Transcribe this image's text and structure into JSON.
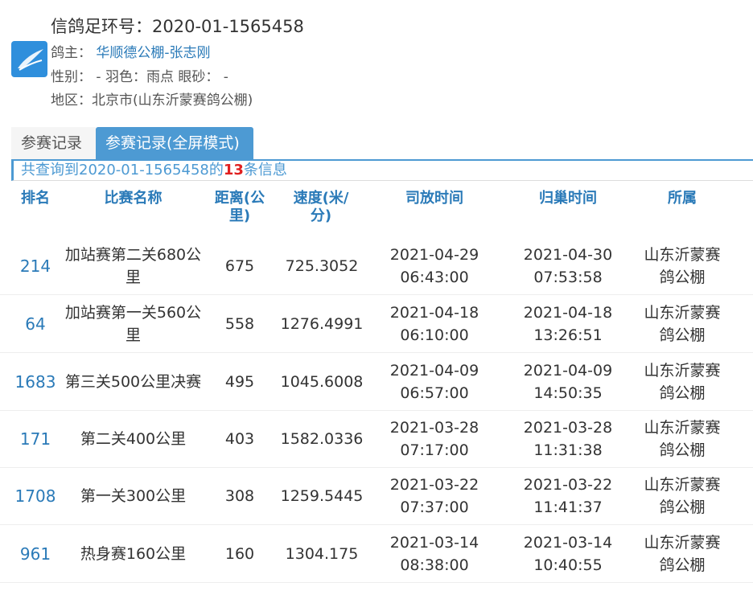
{
  "header": {
    "title": "信鸽足环号：2020-01-1565458",
    "owner_label": "鸽主：",
    "owner_name": "华顺德公棚-张志刚",
    "details": "性别： - 羽色：雨点 眼砂： -",
    "region": "地区：北京市(山东沂蒙赛鸽公棚)"
  },
  "tabs": [
    {
      "label": "参赛记录"
    },
    {
      "label": "参赛记录(全屏模式)"
    }
  ],
  "summary": {
    "prefix": "共查询到2020-01-1565458的",
    "count": "13",
    "suffix": "条信息"
  },
  "table": {
    "headers": [
      "排名",
      "比赛名称",
      "距离(公里)",
      "速度(米/分)",
      "司放时间",
      "归巢时间",
      "所属"
    ],
    "rows": [
      {
        "rank": "214",
        "race": "加站赛第二关680公里",
        "distance": "675",
        "speed": "725.3052",
        "release": "2021-04-29 06:43:00",
        "return": "2021-04-30 07:53:58",
        "org": "山东沂蒙赛鸽公棚"
      },
      {
        "rank": "64",
        "race": "加站赛第一关560公里",
        "distance": "558",
        "speed": "1276.4991",
        "release": "2021-04-18 06:10:00",
        "return": "2021-04-18 13:26:51",
        "org": "山东沂蒙赛鸽公棚"
      },
      {
        "rank": "1683",
        "race": "第三关500公里决赛",
        "distance": "495",
        "speed": "1045.6008",
        "release": "2021-04-09 06:57:00",
        "return": "2021-04-09 14:50:35",
        "org": "山东沂蒙赛鸽公棚"
      },
      {
        "rank": "171",
        "race": "第二关400公里",
        "distance": "403",
        "speed": "1582.0336",
        "release": "2021-03-28 07:17:00",
        "return": "2021-03-28 11:31:38",
        "org": "山东沂蒙赛鸽公棚"
      },
      {
        "rank": "1708",
        "race": "第一关300公里",
        "distance": "308",
        "speed": "1259.5445",
        "release": "2021-03-22 07:37:00",
        "return": "2021-03-22 11:41:37",
        "org": "山东沂蒙赛鸽公棚"
      },
      {
        "rank": "961",
        "race": "热身赛160公里",
        "distance": "160",
        "speed": "1304.175",
        "release": "2021-03-14 08:38:00",
        "return": "2021-03-14 10:40:55",
        "org": "山东沂蒙赛鸽公棚"
      }
    ]
  }
}
